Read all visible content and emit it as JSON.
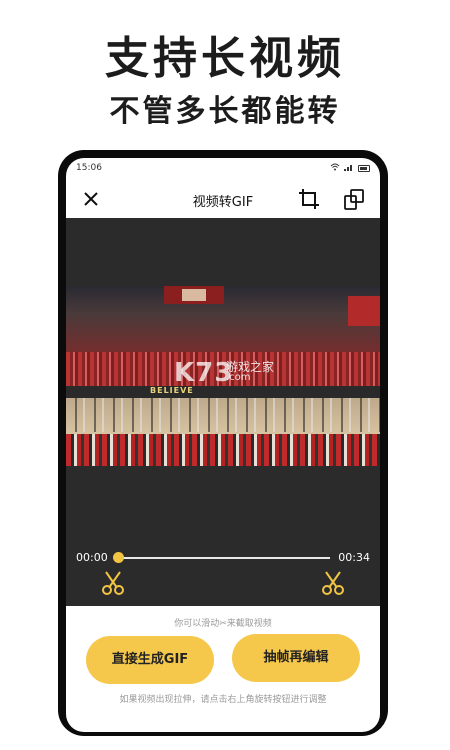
{
  "promo": {
    "headline": "支持长视频",
    "subheadline": "不管多长都能转"
  },
  "status_bar": {
    "time": "15:06",
    "icons": [
      "wifi-icon",
      "signal-icon",
      "battery-icon"
    ]
  },
  "app": {
    "title": "视频转GIF",
    "close_icon": "close-icon",
    "crop_icon": "crop-icon",
    "rotate_icon": "rotate-icon"
  },
  "preview": {
    "ad_text": "BELIEVE",
    "watermark": "K73",
    "watermark_cn": "游戏之家",
    "watermark_domain": ".com"
  },
  "timeline": {
    "start": "00:00",
    "end": "00:34",
    "progress": 0.0
  },
  "actions": {
    "hint_top": "你可以滑动✂来截取视频",
    "generate_label": "直接生成GIF",
    "frames_label": "抽帧再编辑",
    "hint_bottom": "如果视频出现拉伸，请点击右上角旋转按钮进行调整"
  },
  "colors": {
    "accent": "#f5c84c",
    "dark_bg": "#2b2b2b",
    "frame": "#0b0b0b"
  }
}
